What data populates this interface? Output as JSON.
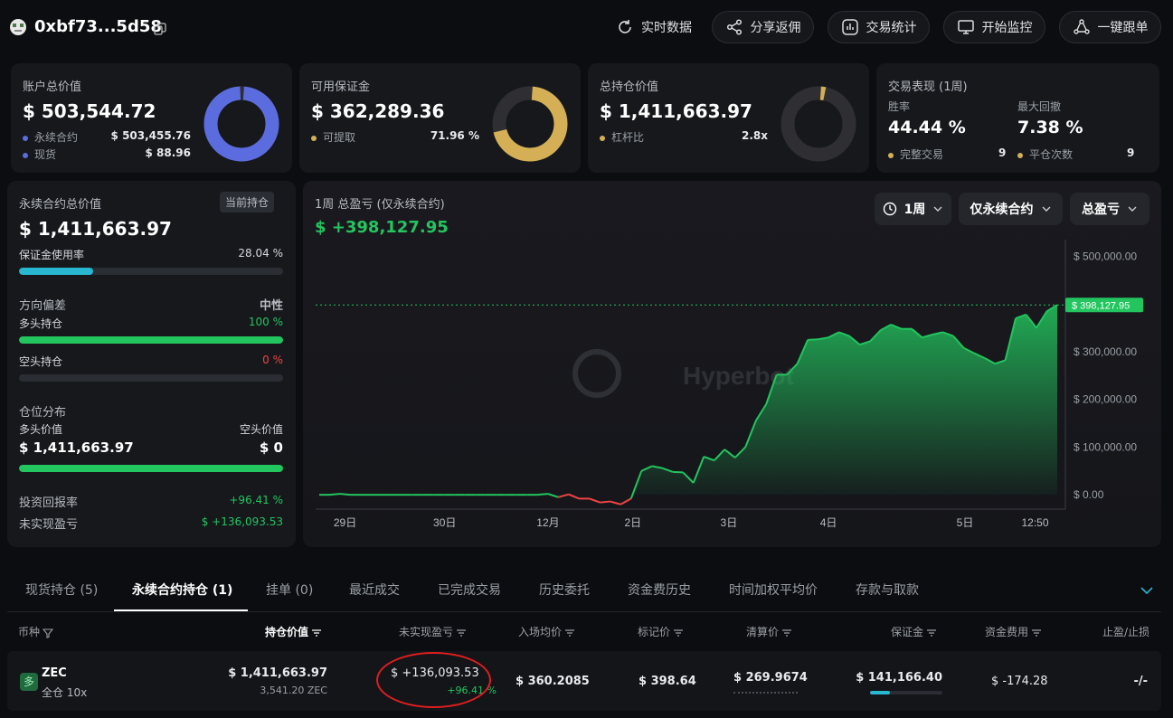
{
  "header": {
    "address": "0xbf73...5d58",
    "buttons": {
      "realtime": "实时数据",
      "share": "分享返佣",
      "stats": "交易统计",
      "monitor": "开始监控",
      "copy": "一键跟单"
    }
  },
  "cards": {
    "account": {
      "title": "账户总价值",
      "value": "$ 503,544.72",
      "row1_label": "永续合约",
      "row1_value": "$ 503,455.76",
      "row2_label": "现货",
      "row2_value": "$ 88.96",
      "donut_fraction": 0.9998,
      "donut_color": "#5b6cde"
    },
    "margin": {
      "title": "可用保证金",
      "value": "$ 362,289.36",
      "row_label": "可提取",
      "row_value": "71.96 %",
      "donut_fraction": 0.7196,
      "donut_color": "#d4af55"
    },
    "position": {
      "title": "总持仓价值",
      "value": "$ 1,411,663.97",
      "row_label": "杠杆比",
      "row_value": "2.8x",
      "donut_fraction": 0.04,
      "donut_color": "#d4af55"
    },
    "performance": {
      "title": "交易表现 (1周)",
      "winrate_label": "胜率",
      "winrate_value": "44.44 %",
      "drawdown_label": "最大回撤",
      "drawdown_value": "7.38 %",
      "trades_label": "完整交易",
      "trades_value": "9",
      "close_label": "平仓次数",
      "close_value": "9"
    }
  },
  "perp_panel": {
    "title": "永续合约总价值",
    "badge": "当前持仓",
    "value": "$ 1,411,663.97",
    "margin_usage_label": "保证金使用率",
    "margin_usage_value": "28.04 %",
    "margin_usage": 0.2804,
    "bias_title": "方向偏差",
    "bias_value": "中性",
    "long_label": "多头持仓",
    "long_value": "100 %",
    "long_fraction": 1.0,
    "short_label": "空头持仓",
    "short_value": "0 %",
    "short_fraction": 0.0,
    "dist_title": "仓位分布",
    "long_val_label": "多头价值",
    "short_val_label": "空头价值",
    "long_val": "$ 1,411,663.97",
    "short_val": "$ 0",
    "dist_long_fraction": 1.0,
    "roi_label": "投资回报率",
    "roi_value": "+96.41 %",
    "upnl_label": "未实现盈亏",
    "upnl_value": "$ +136,093.53"
  },
  "chart_panel": {
    "title": "1周 总盈亏 (仅永续合约)",
    "value": "$ +398,127.95",
    "period": "1周",
    "scope": "仅永续合约",
    "metric": "总盈亏",
    "watermark": "Hyperbot"
  },
  "chart_data": {
    "type": "area",
    "x_ticks": [
      "29日",
      "30日",
      "12月",
      "2日",
      "3日",
      "4日",
      "5日",
      "12:50"
    ],
    "y_ticks": [
      "$ 500,000.00",
      "$ 300,000.00",
      "$ 200,000.00",
      "$ 100,000.00",
      "$ 0.00"
    ],
    "ylim": [
      -30000,
      520000
    ],
    "last_value_label": "$ 398,127.95",
    "last_value": 398128,
    "values": [
      0,
      0,
      2000,
      0,
      0,
      0,
      0,
      0,
      0,
      0,
      0,
      0,
      0,
      0,
      0,
      0,
      0,
      0,
      0,
      0,
      0,
      0,
      2000,
      -5000,
      1000,
      -8000,
      -8000,
      -16000,
      -14000,
      -20000,
      -8000,
      50000,
      60000,
      56000,
      48000,
      47000,
      25000,
      80000,
      72000,
      95000,
      78000,
      100000,
      155000,
      190000,
      252000,
      252000,
      275000,
      325000,
      326000,
      330000,
      341000,
      333000,
      315000,
      322000,
      345000,
      357000,
      348000,
      348000,
      330000,
      336000,
      341000,
      333000,
      308000,
      297000,
      287000,
      275000,
      282000,
      370000,
      378000,
      350000,
      385000,
      398128
    ],
    "colors": {
      "up": "#22c55e",
      "down": "#ef4444"
    }
  },
  "tabs": [
    "现货持仓 (5)",
    "永续合约持仓 (1)",
    "挂单 (0)",
    "最近成交",
    "已完成交易",
    "历史委托",
    "资金费历史",
    "时间加权平均价",
    "存款与取款"
  ],
  "table": {
    "headers": [
      "币种",
      "持仓价值",
      "未实现盈亏",
      "入场均价",
      "标记价",
      "清算价",
      "保证金",
      "资金费用",
      "止盈/止损"
    ],
    "row": {
      "side": "多",
      "coin": "ZEC",
      "mode": "全仓 10x",
      "value": "$ 1,411,663.97",
      "size": "3,541.20 ZEC",
      "upnl": "$ +136,093.53",
      "upnl_pct": "+96.41 %",
      "entry": "$ 360.2085",
      "mark": "$ 398.64",
      "liq": "$ 269.9674",
      "margin": "$ 141,166.40",
      "margin_fraction": 0.28,
      "funding": "$ -174.28",
      "tpsl": "-/-"
    }
  }
}
